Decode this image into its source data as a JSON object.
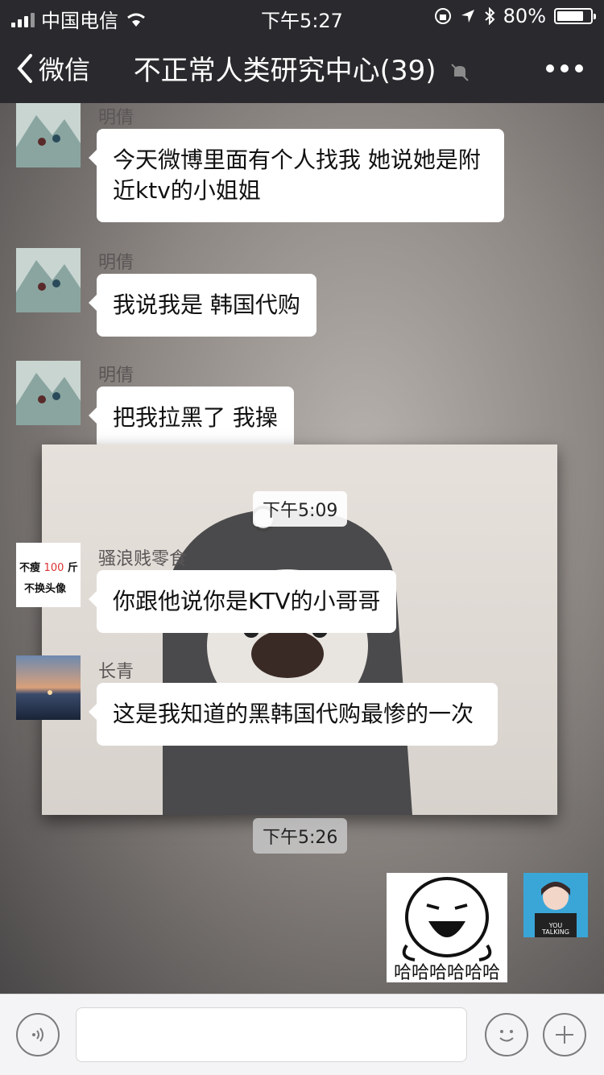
{
  "status": {
    "carrier": "中国电信",
    "time": "下午5:27",
    "battery": "80%",
    "battery_level": 0.8
  },
  "nav": {
    "back_label": "微信",
    "title": "不正常人类研究中心(39)"
  },
  "messages": [
    {
      "sender": "明倩",
      "text": "今天微博里面有个人找我 她说她是附近ktv的小姐姐"
    },
    {
      "sender": "明倩",
      "text": "我说我是 韩国代购"
    },
    {
      "sender": "明倩",
      "text": "把我拉黑了 我操"
    }
  ],
  "image_time": "下午5:09",
  "image_messages": [
    {
      "sender": "骚浪贱零食",
      "text": "你跟他说你是KTV的小哥哥",
      "avatar_text": [
        "不瘦",
        "100",
        "斤",
        "不换头像"
      ]
    },
    {
      "sender": "长青",
      "text": "这是我知道的黑韩国代购最惨的一次"
    }
  ],
  "time_label": "下午5:26",
  "self_sticker": {
    "caption": "哈哈哈哈哈哈"
  },
  "self_avatar_text": "YOU TALKING"
}
